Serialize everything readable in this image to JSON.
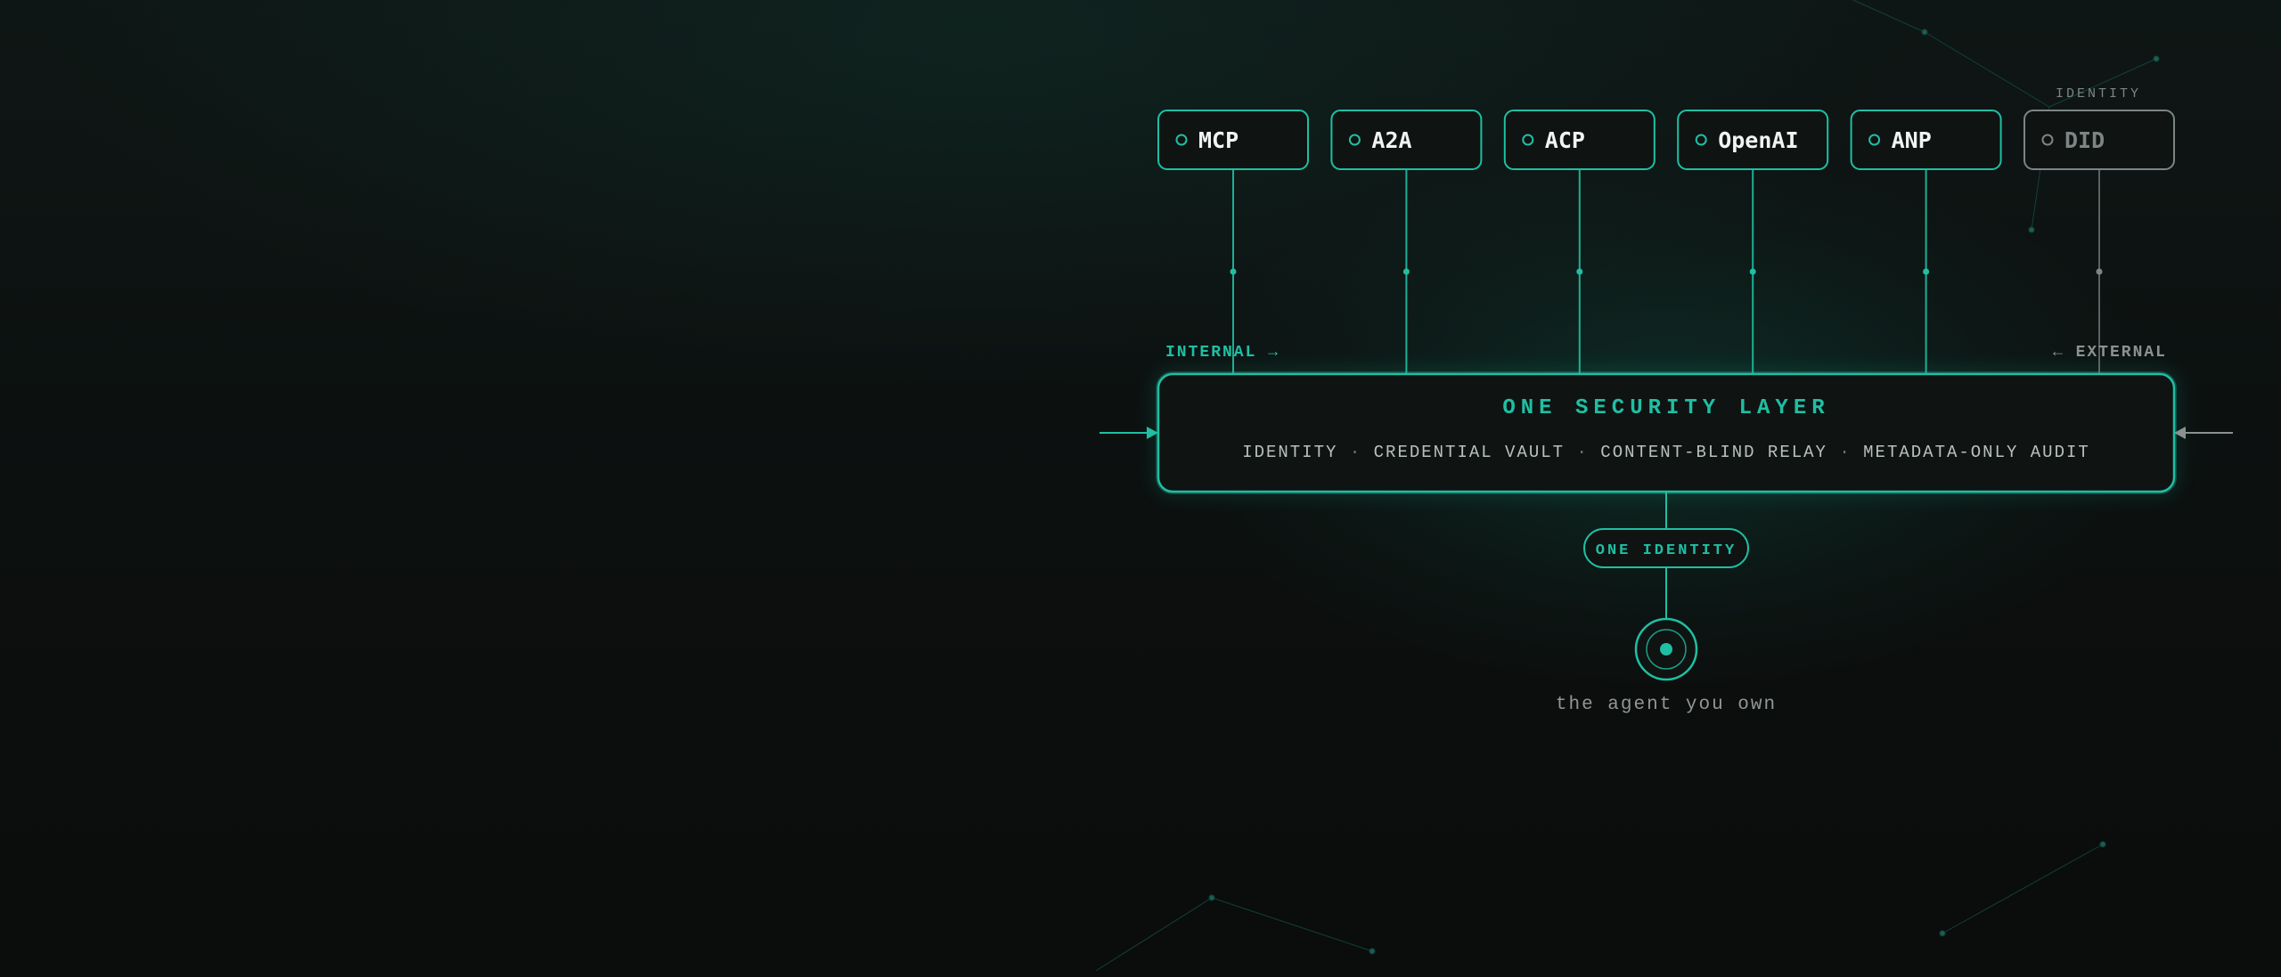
{
  "colors": {
    "accent": "#1fbfa3",
    "accent_dim": "#168f7b",
    "muted": "#7d8584",
    "text_light": "#f2f4f3",
    "panel_bg": "#0f1312"
  },
  "protocols": [
    {
      "label": "MCP",
      "active": true,
      "icon": "ring-icon"
    },
    {
      "label": "A2A",
      "active": true,
      "icon": "ring-icon"
    },
    {
      "label": "ACP",
      "active": true,
      "icon": "ring-icon"
    },
    {
      "label": "OpenAI",
      "active": true,
      "icon": "ring-icon"
    },
    {
      "label": "ANP",
      "active": true,
      "icon": "ring-icon"
    },
    {
      "label": "DID",
      "active": false,
      "icon": "ring-icon",
      "caption": "IDENTITY"
    }
  ],
  "flow": {
    "internal_label": "INTERNAL →",
    "external_label": "← EXTERNAL"
  },
  "security_layer": {
    "title": "ONE SECURITY LAYER",
    "features": [
      "IDENTITY",
      "CREDENTIAL VAULT",
      "CONTENT-BLIND RELAY",
      "METADATA-ONLY AUDIT"
    ],
    "separator": "·"
  },
  "identity_pill": {
    "label": "ONE IDENTITY"
  },
  "agent": {
    "caption": "the agent you own",
    "icon": "target-icon"
  }
}
